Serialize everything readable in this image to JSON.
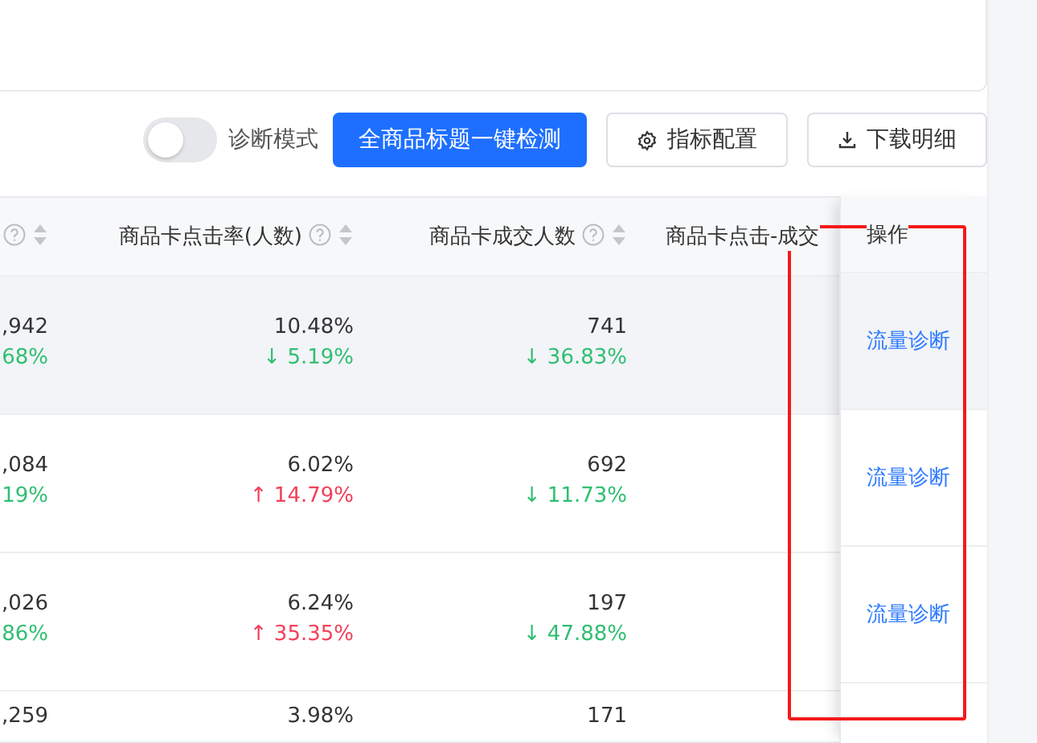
{
  "toolbar": {
    "diagnosis_mode": {
      "label": "诊断模式",
      "on": false
    },
    "buttons": [
      {
        "label": "全商品标题一键检测",
        "kind": "primary"
      },
      {
        "label": "指标配置",
        "kind": "settings"
      },
      {
        "label": "下载明细",
        "kind": "download"
      }
    ]
  },
  "table": {
    "columns": [
      {
        "help": true,
        "sortable": true
      },
      {
        "label": "商品卡点击率(人数)",
        "help": true,
        "sortable": true
      },
      {
        "label": "商品卡成交人数",
        "help": true,
        "sortable": true
      },
      {
        "label": "商品卡点击-成交"
      }
    ],
    "action_column": {
      "label": "操作"
    },
    "rows": [
      {
        "hovered": true,
        "cells": [
          {
            "value": ",942",
            "change": "68%",
            "rising": false
          },
          {
            "value": "10.48%",
            "change": "↓ 5.19%",
            "rising": false
          },
          {
            "value": "741",
            "change": "↓ 36.83%",
            "rising": false
          }
        ],
        "action": "流量诊断"
      },
      {
        "hovered": false,
        "cells": [
          {
            "value": ",084",
            "change": "19%",
            "rising": false
          },
          {
            "value": "6.02%",
            "change": "↑ 14.79%",
            "rising": true
          },
          {
            "value": "692",
            "change": "↓ 11.73%",
            "rising": false
          }
        ],
        "action": "流量诊断"
      },
      {
        "hovered": false,
        "cells": [
          {
            "value": ",026",
            "change": "86%",
            "rising": false
          },
          {
            "value": "6.24%",
            "change": "↑ 35.35%",
            "rising": true
          },
          {
            "value": "197",
            "change": "↓ 47.88%",
            "rising": false
          }
        ],
        "action": "流量诊断"
      },
      {
        "hovered": false,
        "cells": [
          {
            "value": ",259"
          },
          {
            "value": "3.98%"
          },
          {
            "value": "171"
          }
        ]
      }
    ]
  }
}
